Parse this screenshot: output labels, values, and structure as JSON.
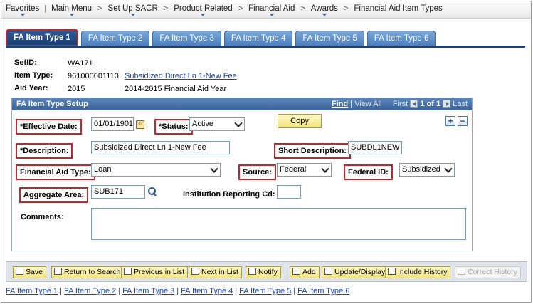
{
  "menu": {
    "items": [
      "Favorites",
      "Main Menu",
      "Set Up SACR",
      "Product Related",
      "Financial Aid",
      "Awards",
      "Financial Aid Item Types"
    ]
  },
  "tabs": [
    "FA Item Type 1",
    "FA Item Type 2",
    "FA Item Type 3",
    "FA Item Type 4",
    "FA Item Type 5",
    "FA Item Type 6"
  ],
  "header": {
    "setid_label": "SetID:",
    "setid_value": "WA171",
    "item_type_label": "Item Type:",
    "item_type_value": "961000001110",
    "item_type_link": "Subsidized Direct Ln 1-New Fee",
    "aid_year_label": "Aid Year:",
    "aid_year_value": "2015",
    "aid_year_desc": "2014-2015 Financial Aid Year"
  },
  "group": {
    "title": "FA Item Type Setup",
    "find": "Find",
    "view_all": "View All",
    "first": "First",
    "count": "1 of 1",
    "last": "Last",
    "plus": "+",
    "minus": "−"
  },
  "form": {
    "effective_date_label": "*Effective Date:",
    "effective_date_value": "01/01/1901",
    "calendar_glyph": "31",
    "status_label": "*Status:",
    "status_value": "Active",
    "copy_label": "Copy",
    "description_label": "*Description:",
    "description_value": "Subsidized Direct Ln 1-New Fee",
    "short_description_label": "Short Description:",
    "short_description_value": "SUBDL1NEW",
    "fa_type_label": "Financial Aid Type:",
    "fa_type_value": "Loan",
    "source_label": "Source:",
    "source_value": "Federal",
    "federal_id_label": "Federal ID:",
    "federal_id_value": "Subsidized",
    "aggregate_area_label": "Aggregate Area:",
    "aggregate_area_value": "SUB171",
    "inst_reporting_label": "Institution Reporting Cd:",
    "inst_reporting_value": "",
    "comments_label": "Comments:",
    "comments_value": ""
  },
  "toolbar": {
    "save": "Save",
    "return_to_search": "Return to Search",
    "previous_in_list": "Previous in List",
    "next_in_list": "Next in List",
    "notify": "Notify",
    "add": "Add",
    "update_display": "Update/Display",
    "include_history": "Include History",
    "correct_history": "Correct History"
  },
  "footer_links": [
    "FA Item Type 1",
    "FA Item Type 2",
    "FA Item Type 3",
    "FA Item Type 4",
    "FA Item Type 5",
    "FA Item Type 6"
  ],
  "colors": {
    "tab_active": "#1d3f74",
    "tab_inactive": "#4a7fbf",
    "highlight_border": "#c0282d",
    "link": "#1a47b8",
    "button_bg": "#f1e37f"
  }
}
